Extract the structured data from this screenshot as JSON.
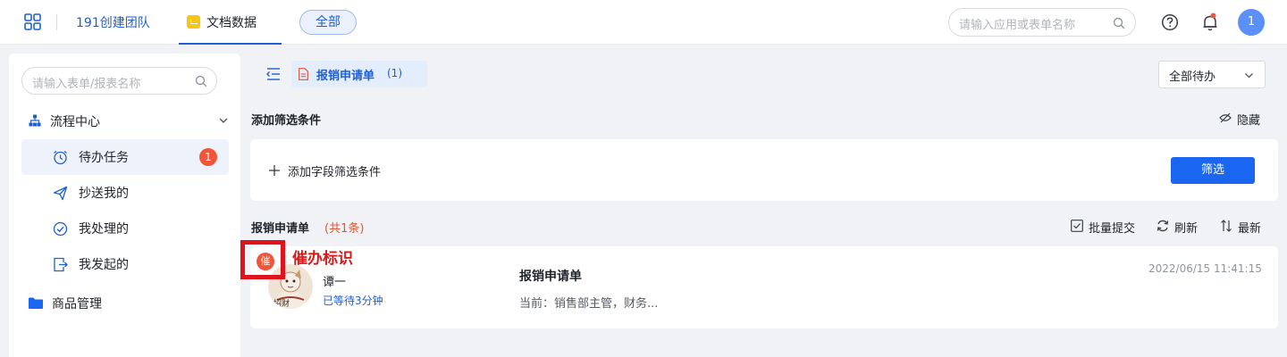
{
  "topbar": {
    "team_name": "191创建团队",
    "doc_tab": "文档数据",
    "all_button": "全部",
    "search_placeholder": "请输入应用或表单名称",
    "avatar_initial": "1"
  },
  "sidebar": {
    "search_placeholder": "请输入表单/报表名称",
    "group_label": "流程中心",
    "items": [
      {
        "label": "待办任务",
        "badge": "1",
        "icon": "alarm-clock-icon",
        "active": true
      },
      {
        "label": "抄送我的",
        "icon": "paper-plane-icon"
      },
      {
        "label": "我处理的",
        "icon": "check-circle-icon"
      },
      {
        "label": "我发起的",
        "icon": "export-doc-icon"
      }
    ],
    "group2_label": "商品管理"
  },
  "main": {
    "form_tab": {
      "label": "报销申请单",
      "count": "(1)"
    },
    "status_select": "全部待办",
    "filter_title": "添加筛选条件",
    "hide_label": "隐藏",
    "add_condition": "添加字段筛选条件",
    "filter_button": "筛选",
    "list_title": "报销申请单",
    "list_count": "(共1条)",
    "actions": {
      "batch_submit": "批量提交",
      "refresh": "刷新",
      "sort": "最新"
    },
    "task": {
      "urge_badge": "催",
      "urge_annotation": "催办标识",
      "user_name": "谭一",
      "wait_time": "已等待3分钟",
      "form_name": "报销申请单",
      "current": "当前：销售部主管，财务...",
      "timestamp": "2022/06/15 11:41:15"
    }
  },
  "colors": {
    "primary": "#1a66f0",
    "accent_blue": "#1f5fcf",
    "badge_red": "#f0573a",
    "annotation_red": "#e0121b"
  }
}
